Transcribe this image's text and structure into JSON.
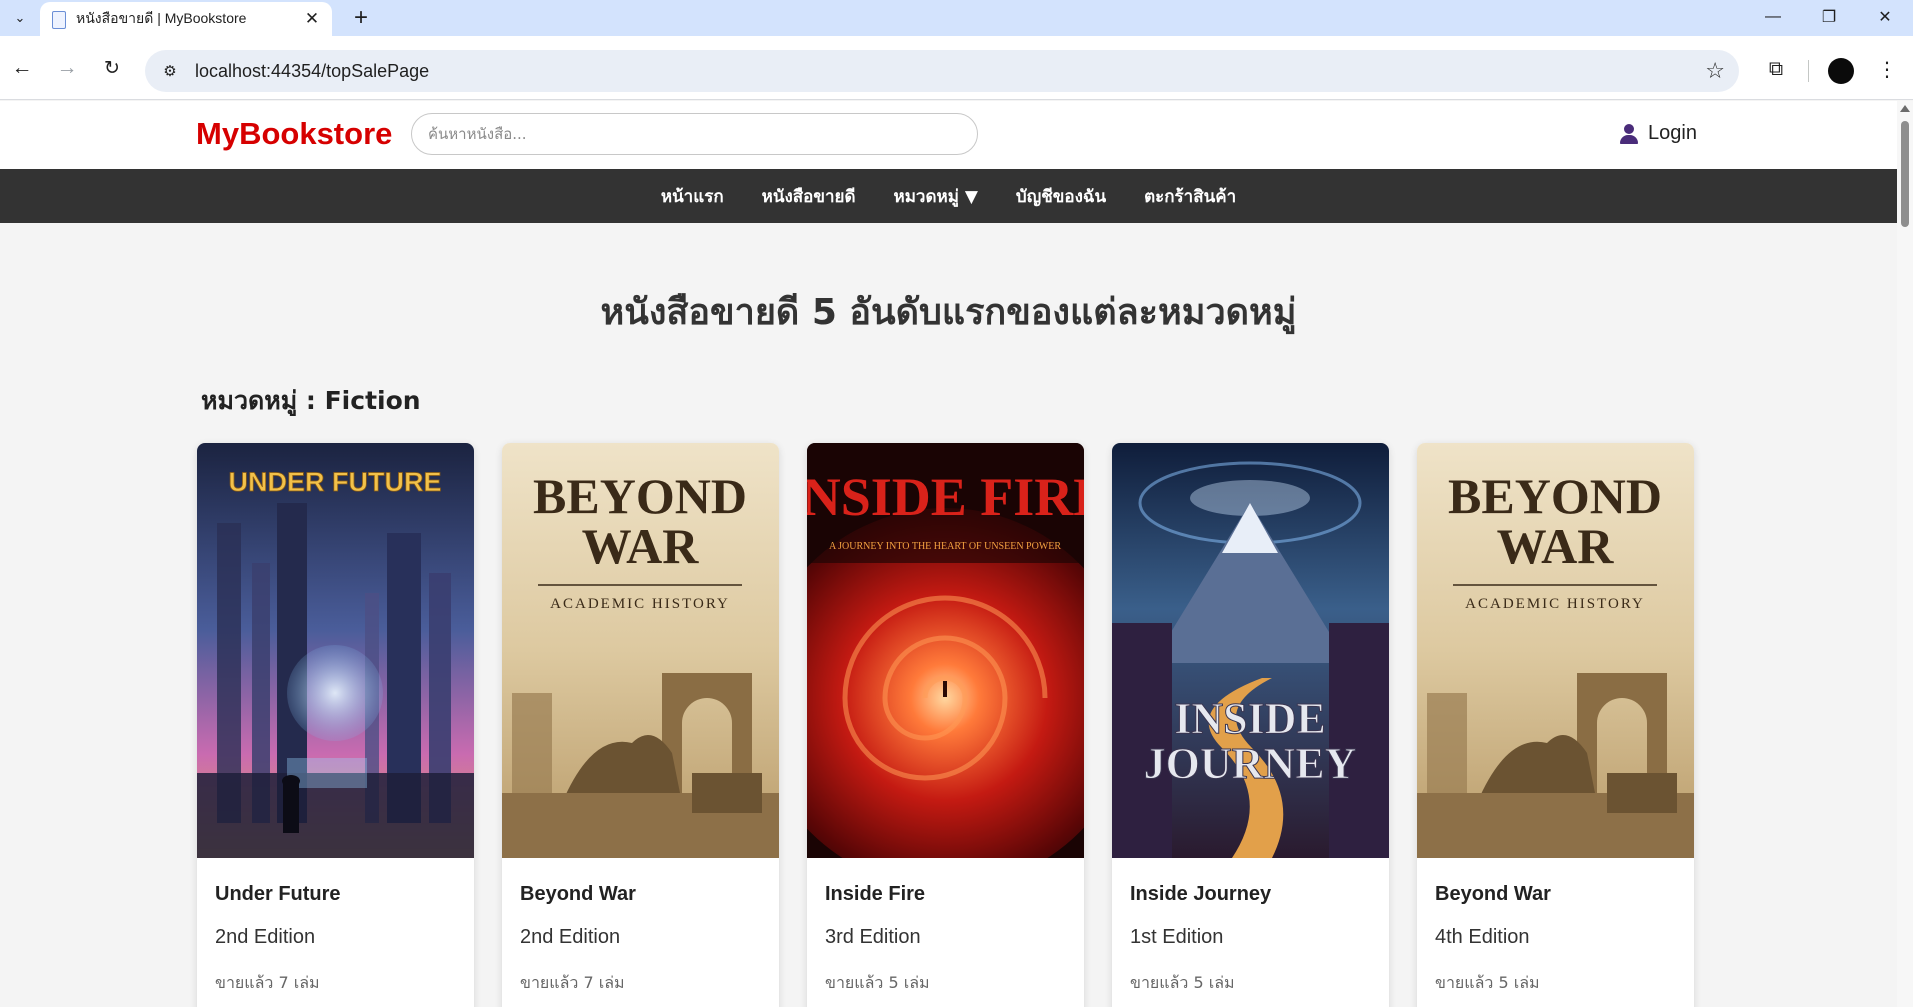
{
  "browser": {
    "tab_title": "หนังสือขายดี | MyBookstore",
    "url": "localhost:44354/topSalePage"
  },
  "header": {
    "logo": "MyBookstore",
    "search_placeholder": "ค้นหาหนังสือ...",
    "login_label": "Login"
  },
  "nav": {
    "items": [
      {
        "label": "หน้าแรก"
      },
      {
        "label": "หนังสือขายดี"
      },
      {
        "label": "หมวดหมู่ ▼"
      },
      {
        "label": "บัญชีของฉัน"
      },
      {
        "label": "ตะกร้าสินค้า"
      }
    ]
  },
  "page": {
    "title": "หนังสือขายดี 5 อันดับแรกของแต่ละหมวดหมู่",
    "category_heading": "หมวดหมู่ : Fiction"
  },
  "books": [
    {
      "title": "Under Future",
      "edition": "2nd Edition",
      "sold": "ขายแล้ว 7 เล่ม",
      "cover_text": "UNDER FUTURE",
      "cover_colors": [
        "#1b2340",
        "#4a5d9a",
        "#c96bb0",
        "#e8a25a"
      ]
    },
    {
      "title": "Beyond War",
      "edition": "2nd Edition",
      "sold": "ขายแล้ว 7 เล่ม",
      "cover_text": "BEYOND WAR",
      "cover_subtitle": "ACADEMIC HISTORY",
      "cover_colors": [
        "#efe3c8",
        "#b89a68",
        "#6b5332"
      ]
    },
    {
      "title": "Inside Fire",
      "edition": "3rd Edition",
      "sold": "ขายแล้ว 5 เล่ม",
      "cover_text": "INSIDE FIRE",
      "cover_subtitle": "A JOURNEY INTO THE HEART OF UNSEEN POWER",
      "cover_colors": [
        "#1a0404",
        "#7a0a0a",
        "#e0331a",
        "#ffb070"
      ]
    },
    {
      "title": "Inside Journey",
      "edition": "1st Edition",
      "sold": "ขายแล้ว 5 เล่ม",
      "cover_text": "INSIDE JOURNEY",
      "cover_colors": [
        "#0f1d3a",
        "#3a5f8a",
        "#6a3b6e",
        "#f0a040"
      ]
    },
    {
      "title": "Beyond War",
      "edition": "4th Edition",
      "sold": "ขายแล้ว 5 เล่ม",
      "cover_text": "BEYOND WAR",
      "cover_subtitle": "ACADEMIC HISTORY",
      "cover_colors": [
        "#efe3c8",
        "#b89a68",
        "#6b5332"
      ]
    }
  ]
}
